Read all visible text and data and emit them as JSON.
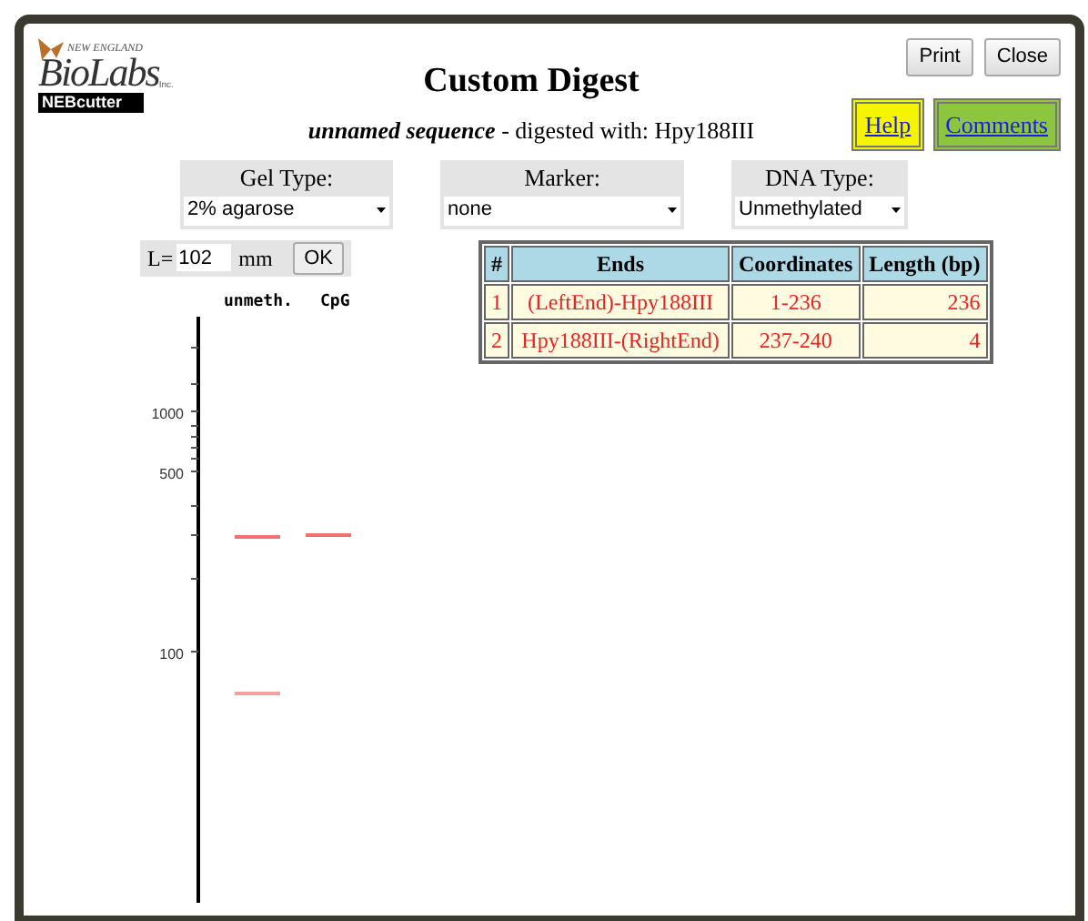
{
  "logo": {
    "top_line": "NEW ENGLAND",
    "name": "BioLabs",
    "suffix": "Inc.",
    "badge": "NEBcutter"
  },
  "title": "Custom Digest",
  "subtitle": {
    "sequence": "unnamed sequence",
    "text": " - digested with: Hpy188III"
  },
  "buttons": [
    "Print",
    "Close"
  ],
  "links": [
    {
      "label": "Help",
      "color": "#f5f500"
    },
    {
      "label": "Comments",
      "color": "#8cc63f"
    }
  ],
  "selectors": [
    {
      "label": "Gel Type:",
      "value": "2% agarose"
    },
    {
      "label": "Marker:",
      "value": "none"
    },
    {
      "label": "DNA Type:",
      "value": "Unmethylated"
    }
  ],
  "length": {
    "label": "L=",
    "value": "102",
    "unit": "mm",
    "button": "OK"
  },
  "gel": {
    "lanes": [
      "unmeth.",
      "CpG"
    ],
    "axis_labels": [
      "1000",
      "500",
      "100"
    ]
  },
  "table": {
    "columns": [
      "#",
      "Ends",
      "Coordinates",
      "Length (bp)"
    ],
    "rows": [
      [
        "1",
        "(LeftEnd)-Hpy188III",
        "1-236",
        "236"
      ],
      [
        "2",
        "Hpy188III-(RightEnd)",
        "237-240",
        "4"
      ]
    ]
  }
}
